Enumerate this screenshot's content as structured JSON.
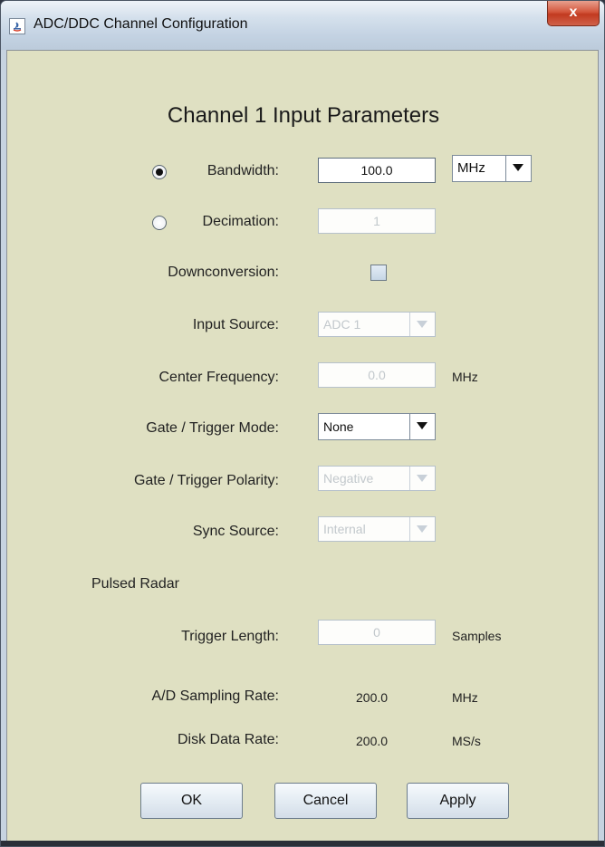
{
  "window": {
    "title": "ADC/DDC Channel Configuration",
    "close_label": "x"
  },
  "dialog": {
    "heading": "Channel 1 Input Parameters"
  },
  "bandwidth": {
    "label": "Bandwidth:",
    "value": "100.0",
    "unit": "MHz",
    "selected": true
  },
  "decimation": {
    "label": "Decimation:",
    "value": "1",
    "selected": false
  },
  "downconversion": {
    "label": "Downconversion:",
    "checked": false
  },
  "input_source": {
    "label": "Input Source:",
    "value": "ADC 1"
  },
  "center_frequency": {
    "label": "Center Frequency:",
    "value": "0.0",
    "unit": "MHz"
  },
  "gate_trigger_mode": {
    "label": "Gate / Trigger Mode:",
    "value": "None"
  },
  "gate_trigger_polarity": {
    "label": "Gate / Trigger Polarity:",
    "value": "Negative"
  },
  "sync_source": {
    "label": "Sync Source:",
    "value": "Internal"
  },
  "pulsed_radar": {
    "section_label": "Pulsed Radar"
  },
  "trigger_length": {
    "label": "Trigger Length:",
    "value": "0",
    "unit": "Samples"
  },
  "sampling_rate": {
    "label": "A/D Sampling Rate:",
    "value": "200.0",
    "unit": "MHz"
  },
  "disk_data_rate": {
    "label": "Disk Data Rate:",
    "value": "200.0",
    "unit": "MS/s"
  },
  "buttons": {
    "ok": "OK",
    "cancel": "Cancel",
    "apply": "Apply"
  }
}
